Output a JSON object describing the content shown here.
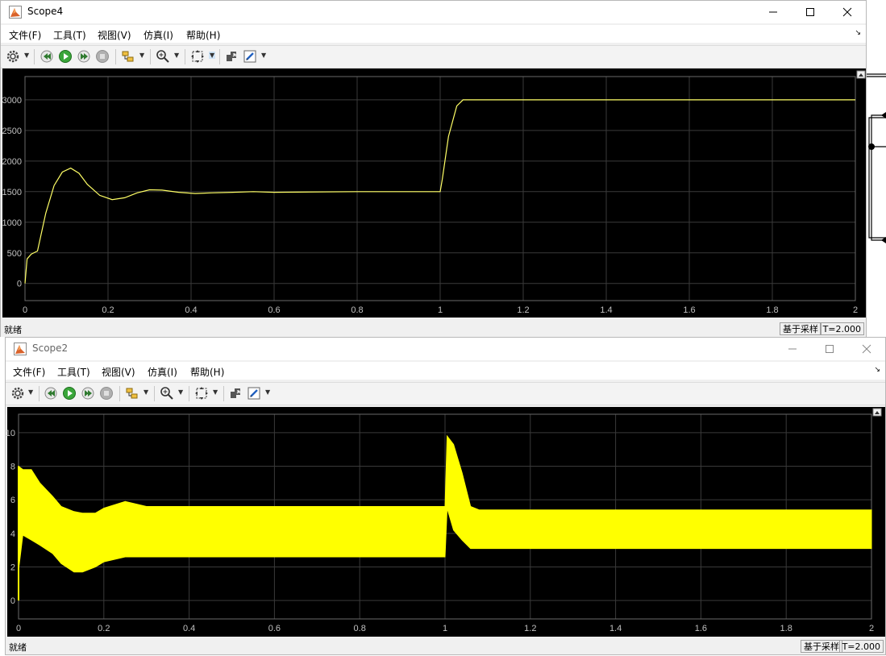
{
  "colors": {
    "plot_bg": "#000000",
    "grid": "#3a3a3a",
    "axis_text": "#c0c0c0",
    "trace1": "#ffff66",
    "trace2": "#ffff00"
  },
  "windows": [
    {
      "title": "Scope4",
      "menu": [
        "文件(F)",
        "工具(T)",
        "视图(V)",
        "仿真(I)",
        "帮助(H)"
      ],
      "status": {
        "text": "就绪",
        "mode": "基于采样",
        "time": "T=2.000"
      },
      "chart_data": {
        "type": "line",
        "xlim": [
          0,
          2
        ],
        "ylim": [
          -280,
          3380
        ],
        "x_ticks": [
          "0",
          "0.2",
          "0.4",
          "0.6",
          "0.8",
          "1",
          "1.2",
          "1.4",
          "1.6",
          "1.8",
          "2"
        ],
        "y_ticks": [
          "0",
          "500",
          "1000",
          "1500",
          "2000",
          "2500",
          "3000"
        ],
        "grid": true,
        "series": [
          {
            "x": [
              0,
              0.005,
              0.015,
              0.03,
              0.05,
              0.07,
              0.09,
              0.11,
              0.13,
              0.15,
              0.18,
              0.21,
              0.24,
              0.27,
              0.3,
              0.33,
              0.37,
              0.41,
              0.45,
              0.5,
              0.55,
              0.6,
              0.8,
              1.0,
              1.005,
              1.02,
              1.04,
              1.055,
              1.07,
              1.1,
              1.5,
              2.0
            ],
            "y": [
              0,
              400,
              480,
              530,
              1150,
              1600,
              1820,
              1885,
              1800,
              1620,
              1440,
              1370,
              1400,
              1480,
              1530,
              1525,
              1490,
              1470,
              1480,
              1490,
              1500,
              1490,
              1500,
              1500,
              1700,
              2400,
              2900,
              3000,
              3000,
              3000,
              3000,
              3000
            ]
          }
        ]
      }
    },
    {
      "title": "Scope2",
      "menu": [
        "文件(F)",
        "工具(T)",
        "视图(V)",
        "仿真(I)",
        "帮助(H)"
      ],
      "status": {
        "text": "就绪",
        "mode": "基于采样",
        "time": "T=2.000"
      },
      "chart_data": {
        "type": "area",
        "xlim": [
          0,
          2
        ],
        "ylim": [
          -1.1,
          11.1
        ],
        "x_ticks": [
          "0",
          "0.2",
          "0.4",
          "0.6",
          "0.8",
          "1",
          "1.2",
          "1.4",
          "1.6",
          "1.8",
          "2"
        ],
        "y_ticks": [
          "0",
          "2",
          "4",
          "6",
          "8",
          "10"
        ],
        "grid": true,
        "series": [
          {
            "x": [
              0,
              0.01,
              0.03,
              0.05,
              0.08,
              0.1,
              0.13,
              0.15,
              0.18,
              0.2,
              0.25,
              0.3,
              0.4,
              0.6,
              0.8,
              1.0,
              1.005,
              1.02,
              1.04,
              1.06,
              1.08,
              1.1,
              1.5,
              2.0
            ],
            "y_max": [
              8.0,
              7.8,
              7.8,
              7.0,
              6.2,
              5.6,
              5.3,
              5.2,
              5.2,
              5.5,
              5.9,
              5.6,
              5.6,
              5.6,
              5.6,
              5.6,
              9.8,
              9.3,
              7.6,
              5.6,
              5.4,
              5.4,
              5.4,
              5.4
            ],
            "y_min": [
              1.8,
              3.9,
              3.6,
              3.3,
              2.8,
              2.2,
              1.7,
              1.7,
              2.0,
              2.3,
              2.6,
              2.6,
              2.6,
              2.6,
              2.6,
              2.6,
              5.5,
              4.2,
              3.6,
              3.1,
              3.1,
              3.1,
              3.1,
              3.1
            ]
          }
        ]
      }
    }
  ]
}
